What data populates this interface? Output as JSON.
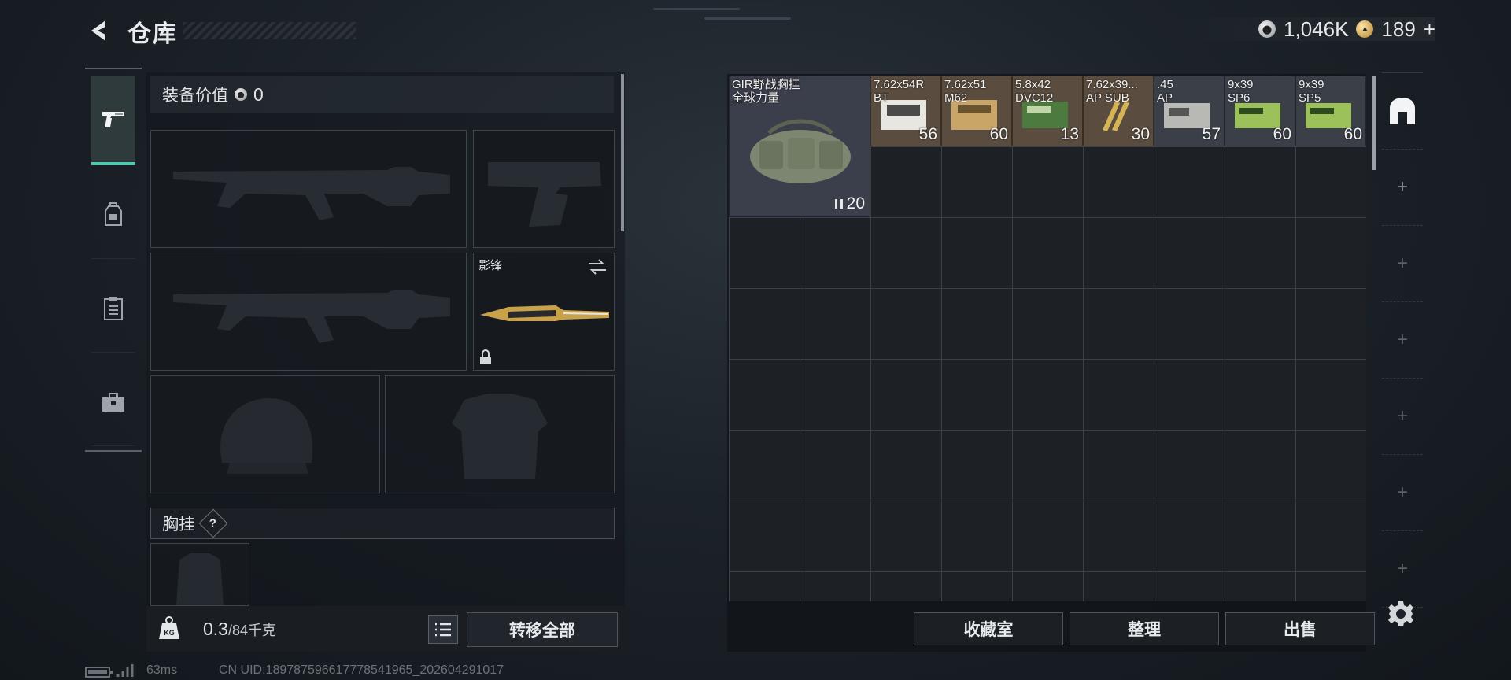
{
  "header": {
    "title": "仓库",
    "currency": [
      {
        "icon": "silver-coin-icon",
        "value": "1,046K"
      },
      {
        "icon": "gold-coin-icon",
        "value": "189"
      }
    ],
    "add_currency": "+"
  },
  "left_tabs": [
    {
      "icon": "pistol-icon",
      "active": true
    },
    {
      "icon": "backpack-icon",
      "active": false
    },
    {
      "icon": "clipboard-icon",
      "active": false
    },
    {
      "icon": "toolbox-icon",
      "active": false
    }
  ],
  "equipment": {
    "value_label": "装备价值",
    "value": "0",
    "melee_label": "影锋",
    "chest_label": "胸挂",
    "chest_help": "?"
  },
  "weight": {
    "icon": "weight-kg-icon",
    "current": "0.3",
    "max": "/84千克"
  },
  "transfer_all": "转移全部",
  "warehouse": {
    "bag": {
      "name_line1": "GIR野战胸挂",
      "name_line2": "全球力量",
      "qty": "20"
    },
    "items": [
      {
        "line1": "7.62x54R",
        "line2": "BT",
        "qty": "56",
        "tone": "white"
      },
      {
        "line1": "7.62x51",
        "line2": "M62",
        "qty": "60",
        "tone": "tan"
      },
      {
        "line1": "5.8x42",
        "line2": "DVC12",
        "qty": "13",
        "tone": "green"
      },
      {
        "line1": "7.62x39...",
        "line2": "AP SUB",
        "qty": "30",
        "tone": "bullets"
      },
      {
        "line1": ".45",
        "line2": "AP",
        "qty": "57",
        "tone": "grey"
      },
      {
        "line1": "9x39",
        "line2": "SP6",
        "qty": "60",
        "tone": "lime"
      },
      {
        "line1": "9x39",
        "line2": "SP5",
        "qty": "60",
        "tone": "lime"
      }
    ]
  },
  "buttons": {
    "collection": "收藏室",
    "organize": "整理",
    "sell": "出售"
  },
  "side_slots": [
    "+",
    "+",
    "+",
    "+",
    "+",
    "+"
  ],
  "status": {
    "ping": "63ms",
    "uid": "CN UID:1897875966177785419​65_202604291017"
  }
}
